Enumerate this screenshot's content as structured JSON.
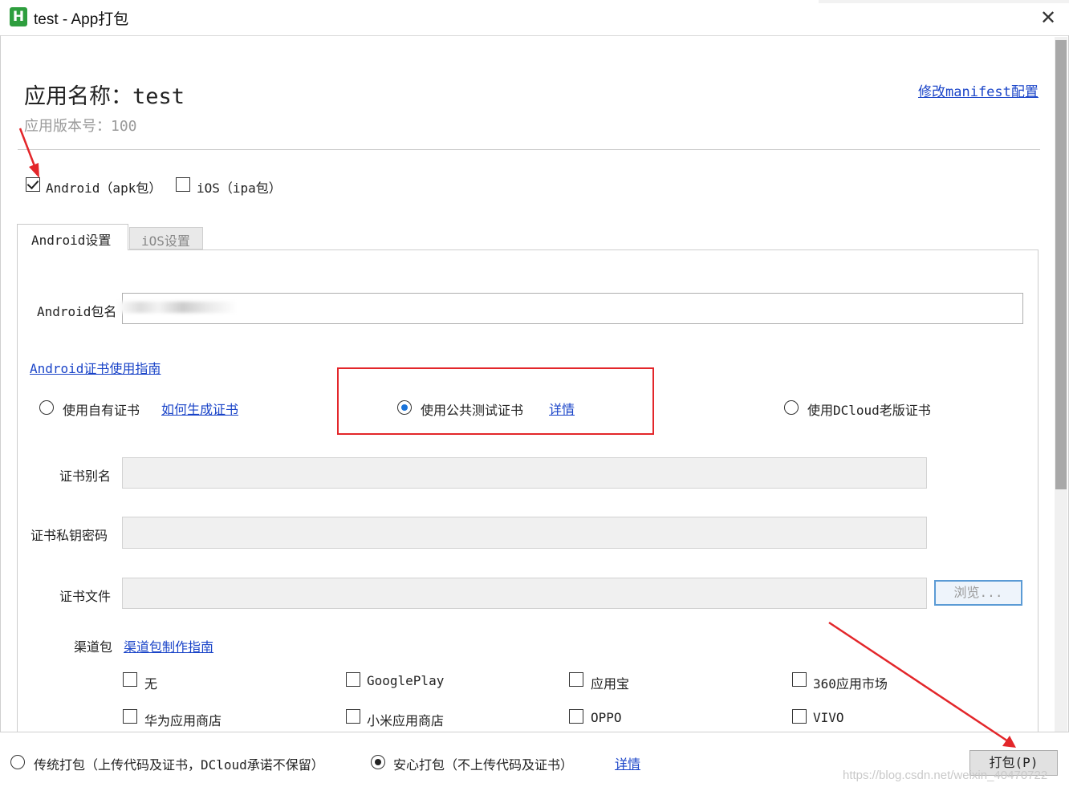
{
  "window": {
    "title": "test - App打包",
    "icon_letter": "H",
    "close_label": "✕"
  },
  "header": {
    "app_name": "应用名称：test",
    "app_version": "应用版本号：100",
    "manifest_link": "修改manifest配置"
  },
  "platforms": {
    "android": {
      "label": "Android（apk包）",
      "checked": true
    },
    "ios": {
      "label": "iOS（ipa包）",
      "checked": false
    }
  },
  "tabs": [
    {
      "label": "Android设置",
      "active": true
    },
    {
      "label": "iOS设置",
      "active": false
    }
  ],
  "android_settings": {
    "package_name_label": "Android包名",
    "package_name_value": "",
    "cert_guide_link": "Android证书使用指南",
    "cert_options": {
      "own": {
        "label": "使用自有证书",
        "link": "如何生成证书",
        "selected": false
      },
      "public": {
        "label": "使用公共测试证书",
        "link": "详情",
        "selected": true
      },
      "dcloud_old": {
        "label": "使用DCloud老版证书",
        "selected": false
      }
    },
    "cert_alias_label": "证书别名",
    "cert_password_label": "证书私钥密码",
    "cert_file_label": "证书文件",
    "browse_label": "浏览...",
    "channel_label": "渠道包",
    "channel_guide_link": "渠道包制作指南",
    "channels": [
      {
        "label": "无",
        "checked": false
      },
      {
        "label": "GooglePlay",
        "checked": false
      },
      {
        "label": "应用宝",
        "checked": false
      },
      {
        "label": "360应用市场",
        "checked": false
      },
      {
        "label": "华为应用商店",
        "checked": false
      },
      {
        "label": "小米应用商店",
        "checked": false
      },
      {
        "label": "OPPO",
        "checked": false
      },
      {
        "label": "VIVO",
        "checked": false
      }
    ]
  },
  "footer": {
    "traditional_label": "传统打包（上传代码及证书，DCloud承诺不保留）",
    "traditional_selected": false,
    "safe_label": "安心打包（不上传代码及证书）",
    "safe_selected": true,
    "details_link": "详情",
    "pack_button": "打包(P)",
    "watermark": "https://blog.csdn.net/weixin_40470722"
  },
  "colors": {
    "link": "#1a44c8",
    "annotation_red": "#e3262a",
    "radio_selected": "#1a73d9"
  }
}
